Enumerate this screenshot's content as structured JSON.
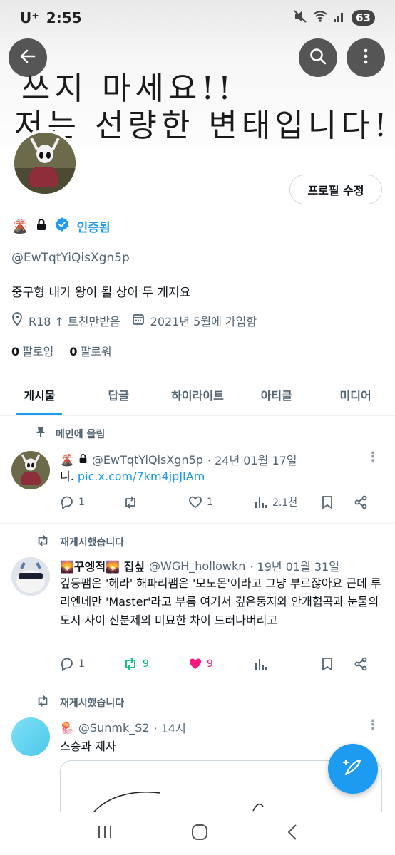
{
  "status": {
    "carrier": "U⁺",
    "time": "2:55",
    "battery": "63"
  },
  "banner": {
    "line1": "쓰지 마세요!!",
    "line2": "저는 선량한 변태입니다!!"
  },
  "header": {
    "back_icon": "arrow-left-icon",
    "search_icon": "search-icon",
    "more_icon": "more-vertical-icon"
  },
  "profile": {
    "edit_label": "프로필 수정",
    "name_emoji": "🌋",
    "verified_label": "인증됨",
    "handle": "@EwTqtYiQisXgn5p",
    "bio": "중구형 내가 왕이 될 상이 두 개지요",
    "location": "R18 ↑ 트친만받음",
    "joined": "2021년 5월에 가입함",
    "following_count": "0",
    "following_label": "팔로잉",
    "followers_count": "0",
    "followers_label": "팔로워"
  },
  "tabs": [
    "게시물",
    "답글",
    "하이라이트",
    "아티클",
    "미디어"
  ],
  "posts": [
    {
      "context": "메인에 올림",
      "name": "🌋",
      "handle": "@EwTqtYiQisXgn5p",
      "date": "· 24년 01월 17일",
      "text_prefix": "니. ",
      "link": "pic.x.com/7km4jpJIAm",
      "replies": "1",
      "reposts": "",
      "likes": "1",
      "views": "2.1천"
    },
    {
      "context": "재게시했습니다",
      "name": "🌄꾸엥적🌄 집싶",
      "handle": "@WGH_hollowkn",
      "date": "· 19년 01월 31일",
      "text": "깊둥팸은 '헤라' 해파리팸은 '모노몬'이라고 그냥 부르잖아요 근데 루리엔네만 'Master'라고 부름 여기서 깊은둥지와 안개협곡과 눈물의도시 사이 신분제의 미묘한 차이 드러나버리고",
      "replies": "1",
      "reposts": "9",
      "likes": "9",
      "views": ""
    },
    {
      "context": "재게시했습니다",
      "name": "🪼",
      "handle": "@Sunmk_S2",
      "date": "· 14시",
      "text": "스승과 제자"
    }
  ],
  "colors": {
    "accent": "#1d9bf0",
    "like": "#f91880",
    "repost": "#00ba7c"
  }
}
